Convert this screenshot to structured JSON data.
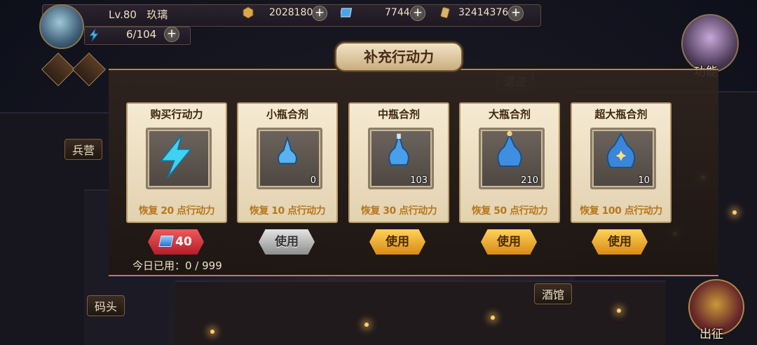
{
  "player": {
    "level": "Lv.80",
    "name": "玖璃",
    "stamina": "6/104"
  },
  "resources": [
    {
      "icon": "coin-icon",
      "value": "2028180"
    },
    {
      "icon": "gem-icon",
      "value": "7744"
    },
    {
      "icon": "scroll-icon",
      "value": "32414376"
    }
  ],
  "map_labels": {
    "barracks": "兵营",
    "dock": "码头",
    "tavern": "酒馆",
    "ruins": "遗迹"
  },
  "right_menu": {
    "function": "功能",
    "depart": "出征"
  },
  "dialog": {
    "title": "补充行动力",
    "cards": [
      {
        "title": "购买行动力",
        "icon": "lightning-icon",
        "count": "",
        "desc": "恢复 20 点行动力"
      },
      {
        "title": "小瓶合剂",
        "icon": "small-potion-icon",
        "count": "0",
        "desc": "恢复 10 点行动力"
      },
      {
        "title": "中瓶合剂",
        "icon": "medium-potion-icon",
        "count": "103",
        "desc": "恢复 30 点行动力"
      },
      {
        "title": "大瓶合剂",
        "icon": "large-potion-icon",
        "count": "210",
        "desc": "恢复 50 点行动力"
      },
      {
        "title": "超大瓶合剂",
        "icon": "xl-potion-icon",
        "count": "10",
        "desc": "恢复 100 点行动力"
      }
    ],
    "buy_price": "40",
    "use_label": "使用",
    "daily_used": "今日已用：0 / 999"
  }
}
